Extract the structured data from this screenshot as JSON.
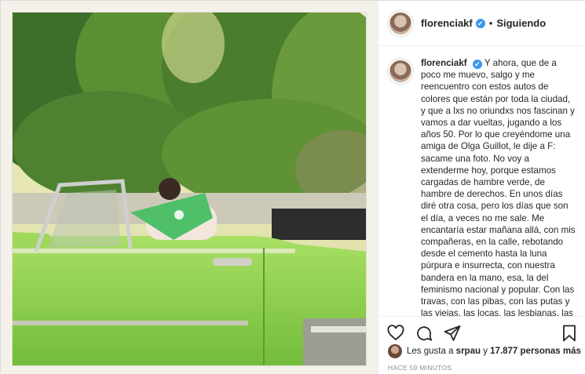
{
  "header": {
    "username": "florenciakf",
    "verified_badge": "✔",
    "separator": "•",
    "follow_status": "Siguiendo"
  },
  "caption": {
    "username": "florenciakf",
    "text": "Y ahora, que de a poco me muevo, salgo y me reencuentro con estos autos de colores que están por toda la ciudad, y que a lxs no oriundxs nos fascinan y vamos a dar vueltas, jugando a los años 50. Por lo que creyéndome una amiga de Olga Guillot, le dije a F: sacame una foto. No voy a extenderme hoy, porque estamos cargadas de hambre verde, de hambre de derechos. En unos días diré otra cosa, pero los días que son el día, a veces no me sale. Me encantaría estar mañana allá, con mis compañeras, en la calle, rebotando desde el cemento hasta la luna púrpura e insurrecta, con nuestra bandera en la mano, esa, la del feminismo nacional y popular. Con las travas, con las pibas, con las putas y las viejas, las locas, las lesbianas, las migrantes, las madres y abuelas. Sé: voy a poder de vuelta. Y las que no"
  },
  "actions": {
    "like_icon": "heart-icon",
    "comment_icon": "comment-icon",
    "share_icon": "share-icon",
    "save_icon": "bookmark-icon"
  },
  "likes": {
    "prefix": "Les gusta a",
    "user": "srpau",
    "connector": "y",
    "count_text": "17.877 personas más"
  },
  "timestamp": "HACE 59 MINUTOS",
  "colors": {
    "verified": "#3897f0",
    "car_green": "#8fd14f",
    "bandana_green": "#4fbf6a"
  }
}
